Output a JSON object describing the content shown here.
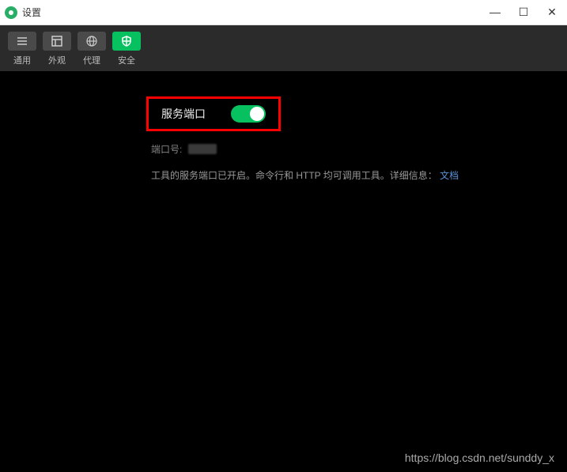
{
  "titlebar": {
    "title": "设置"
  },
  "tabs": [
    {
      "id": "general",
      "label": "通用"
    },
    {
      "id": "appearance",
      "label": "外观"
    },
    {
      "id": "proxy",
      "label": "代理"
    },
    {
      "id": "security",
      "label": "安全"
    }
  ],
  "active_tab": "security",
  "security": {
    "service_port_label": "服务端口",
    "service_port_enabled": true,
    "port_label": "端口号:",
    "description_prefix": "工具的服务端口已开启。命令行和 HTTP 均可调用工具。详细信息：",
    "doc_link_text": "文档"
  },
  "watermark": "https://blog.csdn.net/sunddy_x",
  "colors": {
    "accent": "#07c160",
    "highlight": "#f00",
    "link": "#5a8fd6"
  }
}
